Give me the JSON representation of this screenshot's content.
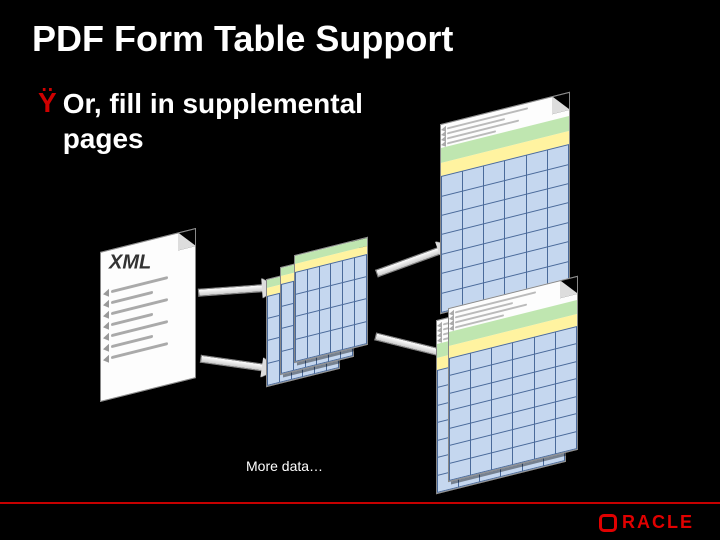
{
  "slide": {
    "title": "PDF Form Table Support",
    "bullet_glyph": "Ÿ",
    "bullet_text": "Or, fill in supplemental pages",
    "caption": "More data…"
  },
  "diagram": {
    "source_label": "XML"
  },
  "footer": {
    "brand": "RACLE"
  }
}
